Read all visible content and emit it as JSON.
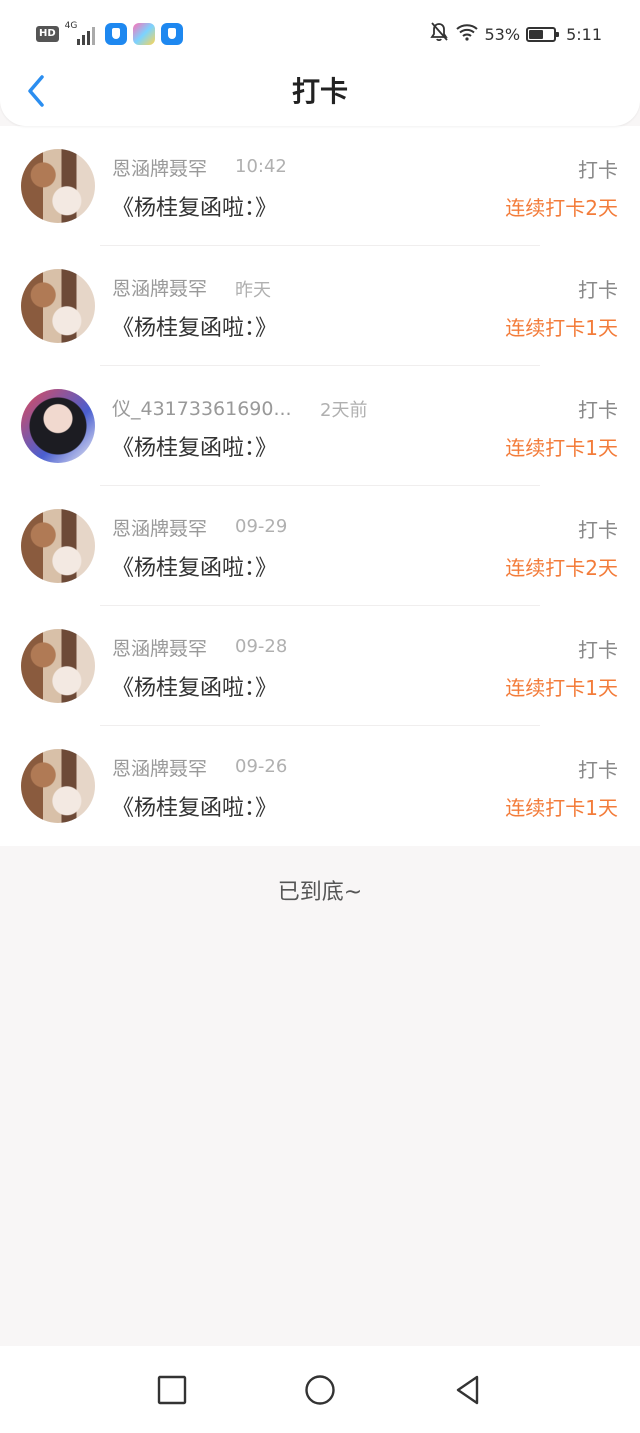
{
  "status_bar": {
    "hd": "HD",
    "network": "4G",
    "battery_percent": "53%",
    "time": "5:11",
    "icons": [
      "signal-icon",
      "shield-app-icon",
      "game-app-icon",
      "shield-app-icon",
      "bell-off-icon",
      "wifi-icon",
      "battery-icon"
    ]
  },
  "header": {
    "title": "打卡",
    "back_icon": "chevron-left-icon"
  },
  "colors": {
    "accent_blue": "#2b8ef0",
    "streak_orange": "#f37c3a",
    "muted_text": "#999999"
  },
  "checkins": [
    {
      "name": "恩涵牌聂罕",
      "time": "10:42",
      "content": "《杨桂复函啦：》",
      "type": "打卡",
      "streak": "连续打卡2天",
      "avatar": "a"
    },
    {
      "name": "恩涵牌聂罕",
      "time": "昨天",
      "content": "《杨桂复函啦：》",
      "type": "打卡",
      "streak": "连续打卡1天",
      "avatar": "a"
    },
    {
      "name": "仪_43173361690...",
      "time": "2天前",
      "content": "《杨桂复函啦：》",
      "type": "打卡",
      "streak": "连续打卡1天",
      "avatar": "b"
    },
    {
      "name": "恩涵牌聂罕",
      "time": "09-29",
      "content": "《杨桂复函啦：》",
      "type": "打卡",
      "streak": "连续打卡2天",
      "avatar": "a"
    },
    {
      "name": "恩涵牌聂罕",
      "time": "09-28",
      "content": "《杨桂复函啦：》",
      "type": "打卡",
      "streak": "连续打卡1天",
      "avatar": "a"
    },
    {
      "name": "恩涵牌聂罕",
      "time": "09-26",
      "content": "《杨桂复函啦：》",
      "type": "打卡",
      "streak": "连续打卡1天",
      "avatar": "a"
    }
  ],
  "end_text": "已到底~",
  "system_nav": [
    "square-icon",
    "circle-icon",
    "triangle-back-icon"
  ]
}
